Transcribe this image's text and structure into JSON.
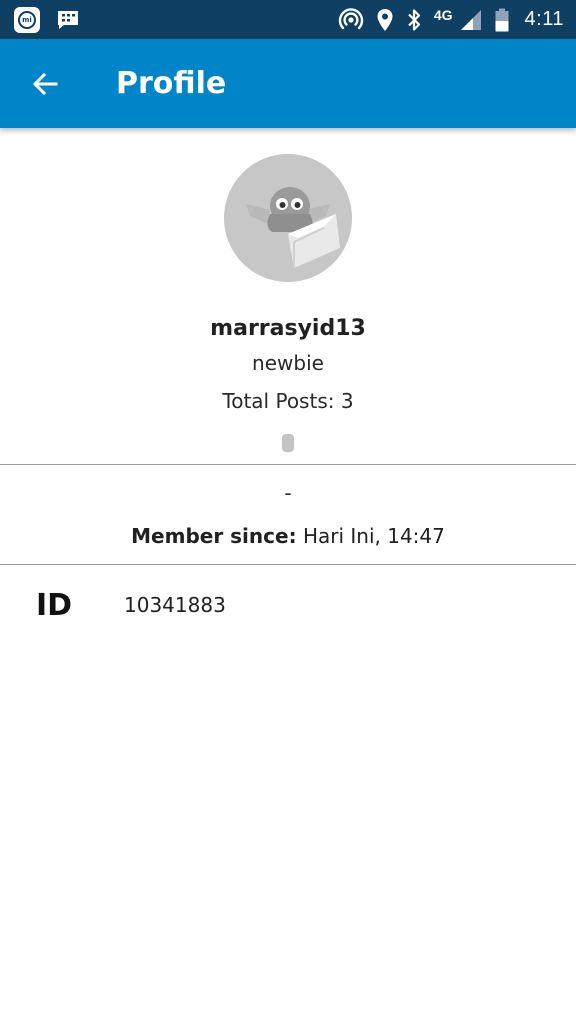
{
  "status_bar": {
    "network_type": "4G",
    "time": "4:11",
    "mi_label": "mi",
    "icons": [
      "mi-notification-icon",
      "bbm-icon",
      "hotspot-icon",
      "location-icon",
      "bluetooth-icon",
      "signal-icon",
      "battery-icon"
    ]
  },
  "app_bar": {
    "title": "Profile",
    "background_color": "#0085c9"
  },
  "profile": {
    "username": "marrasyid13",
    "rank": "newbie",
    "total_posts_label": "Total Posts:",
    "total_posts_value": "3",
    "custom_title": "-",
    "member_since_label": "Member since:",
    "member_since_value": "Hari Ini, 14:47"
  },
  "details": {
    "id_label": "ID",
    "id_value": "10341883"
  }
}
